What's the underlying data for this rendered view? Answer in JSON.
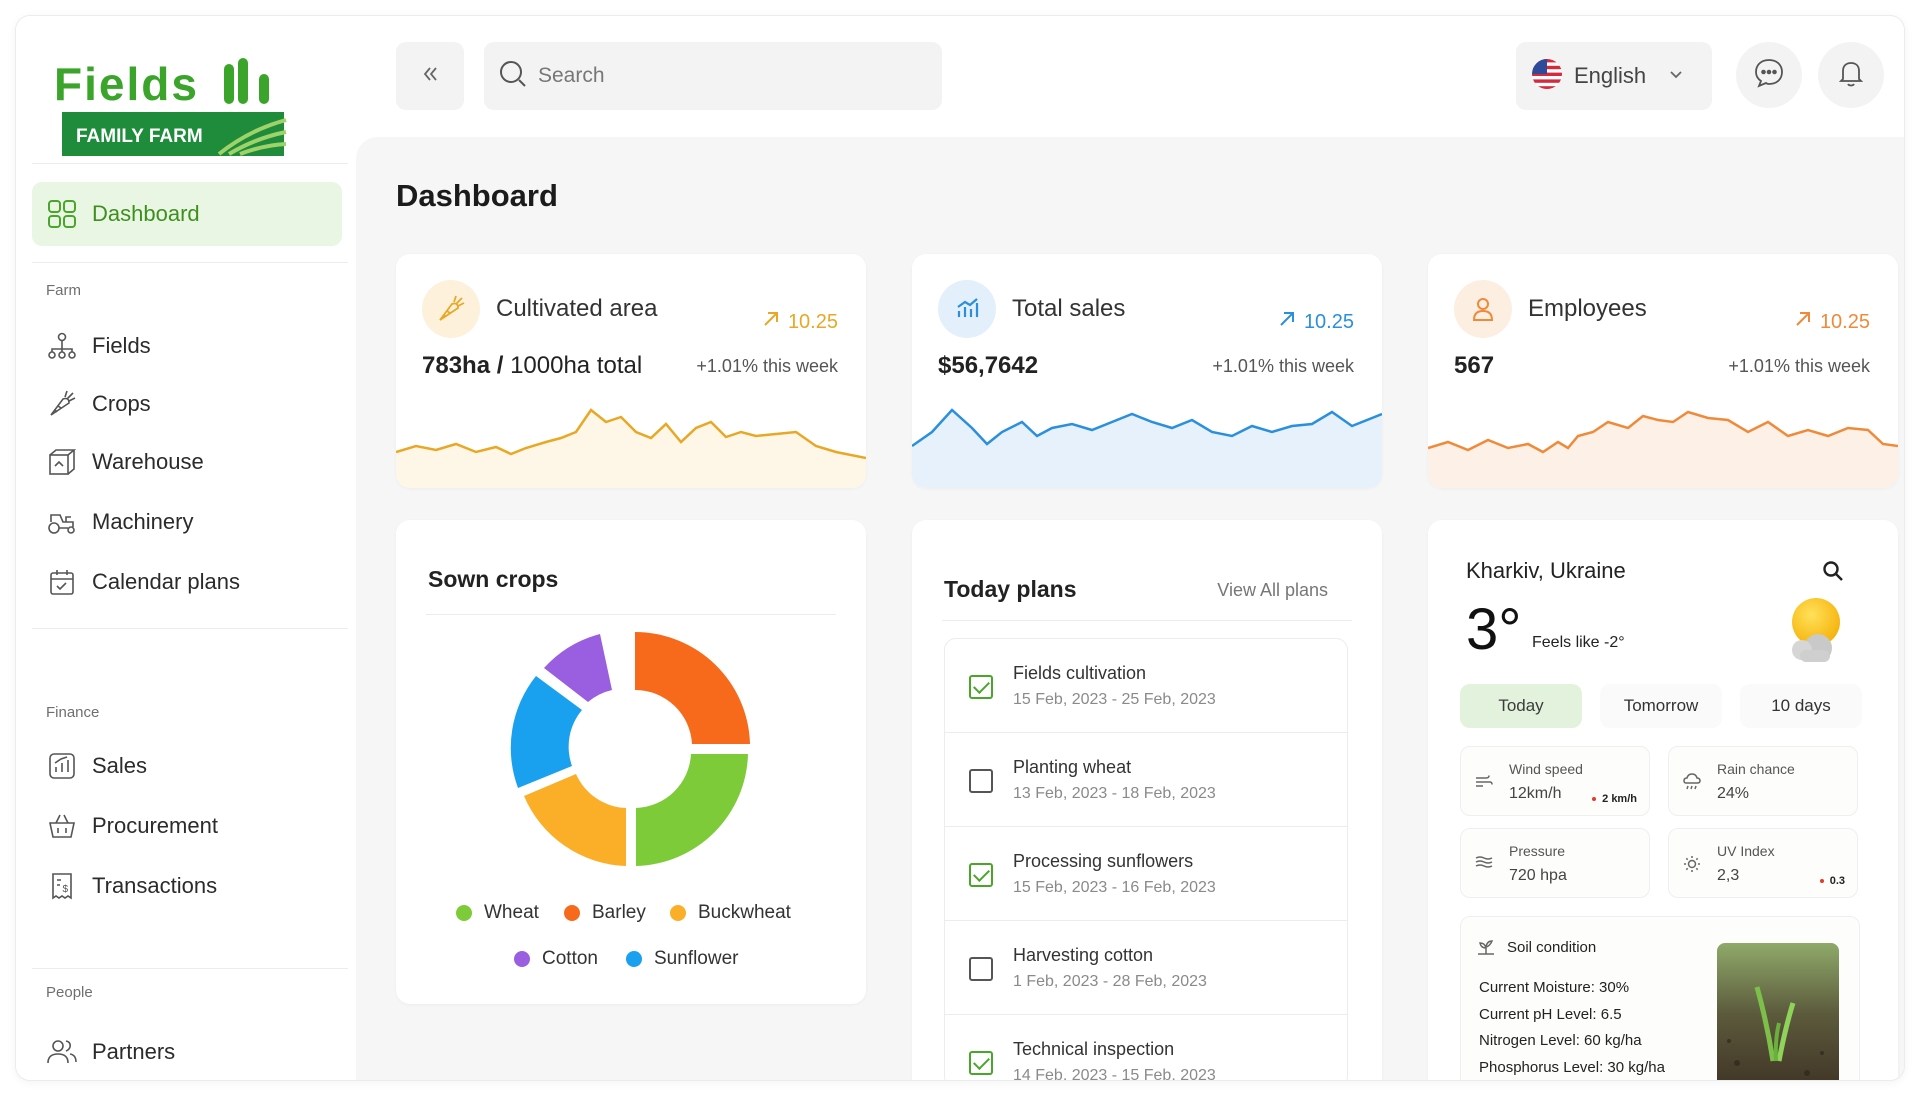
{
  "brand": {
    "name": "Fields",
    "tagline": "FAMILY FARM"
  },
  "sidebar": {
    "dashboard": "Dashboard",
    "sections": {
      "farm": "Farm",
      "finance": "Finance",
      "people": "People"
    },
    "farm_items": [
      "Fields",
      "Crops",
      "Warehouse",
      "Machinery",
      "Calendar plans"
    ],
    "finance_items": [
      "Sales",
      "Procurement",
      "Transactions"
    ],
    "people_items": [
      "Partners"
    ]
  },
  "header": {
    "search_placeholder": "Search",
    "language": "English"
  },
  "page": {
    "title": "Dashboard"
  },
  "stats": [
    {
      "title": "Cultivated area",
      "value_bold": "783ha /",
      "value_rest": "1000ha total",
      "trend": "10.25",
      "week": "+1.01% this week",
      "color": "#e8a825",
      "fill": "#fef7e8",
      "icon": "carrot-icon"
    },
    {
      "title": "Total sales",
      "value_bold": "$56,7642",
      "value_rest": "",
      "trend": "10.25",
      "week": "+1.01% this week",
      "color": "#2a8fdc",
      "fill": "#e6f1fb",
      "icon": "chart-icon"
    },
    {
      "title": "Employees",
      "value_bold": "567",
      "value_rest": "",
      "trend": "10.25",
      "week": "+1.01% this week",
      "color": "#ef8a3a",
      "fill": "#fdf0e6",
      "icon": "user-icon"
    }
  ],
  "sown_crops": {
    "title": "Sown crops",
    "legend": [
      {
        "name": "Wheat",
        "color": "#7ecb3a"
      },
      {
        "name": "Barley",
        "color": "#f76a1c"
      },
      {
        "name": "Buckwheat",
        "color": "#fbae28"
      },
      {
        "name": "Cotton",
        "color": "#9a5ee0"
      },
      {
        "name": "Sunflower",
        "color": "#19a0ef"
      }
    ]
  },
  "plans": {
    "title": "Today plans",
    "view_all": "View All plans",
    "items": [
      {
        "name": "Fields cultivation",
        "date": "15 Feb, 2023 - 25 Feb, 2023",
        "checked": true
      },
      {
        "name": "Planting wheat",
        "date": "13 Feb, 2023 - 18 Feb, 2023",
        "checked": false
      },
      {
        "name": "Processing sunflowers",
        "date": "15 Feb, 2023 - 16 Feb, 2023",
        "checked": true
      },
      {
        "name": "Harvesting cotton",
        "date": "1 Feb, 2023 - 28 Feb, 2023",
        "checked": false
      },
      {
        "name": "Technical inspection",
        "date": "14 Feb, 2023 - 15 Feb, 2023",
        "checked": true
      }
    ]
  },
  "weather": {
    "location": "Kharkiv, Ukraine",
    "temp": "3°",
    "feels_like": "Feels like -2°",
    "tabs": [
      "Today",
      "Tomorrow",
      "10 days"
    ],
    "cells": [
      {
        "label": "Wind speed",
        "value": "12km/h",
        "delta": "2 km/h",
        "delta_color": "#4aa62b",
        "icon": "wind-icon"
      },
      {
        "label": "Rain chance",
        "value": "24%",
        "delta": "",
        "delta_color": "",
        "icon": "rain-icon"
      },
      {
        "label": "Pressure",
        "value": "720 hpa",
        "delta": "",
        "delta_color": "",
        "icon": "pressure-icon"
      },
      {
        "label": "UV Index",
        "value": "2,3",
        "delta": "0.3",
        "delta_color": "#e23b2e",
        "icon": "sun-icon"
      }
    ],
    "soil": {
      "title": "Soil condition",
      "lines": [
        "Current Moisture: 30%",
        "Current pH Level: 6.5",
        "Nitrogen Level: 60 kg/ha",
        "Phosphorus Level: 30 kg/ha"
      ]
    }
  }
}
